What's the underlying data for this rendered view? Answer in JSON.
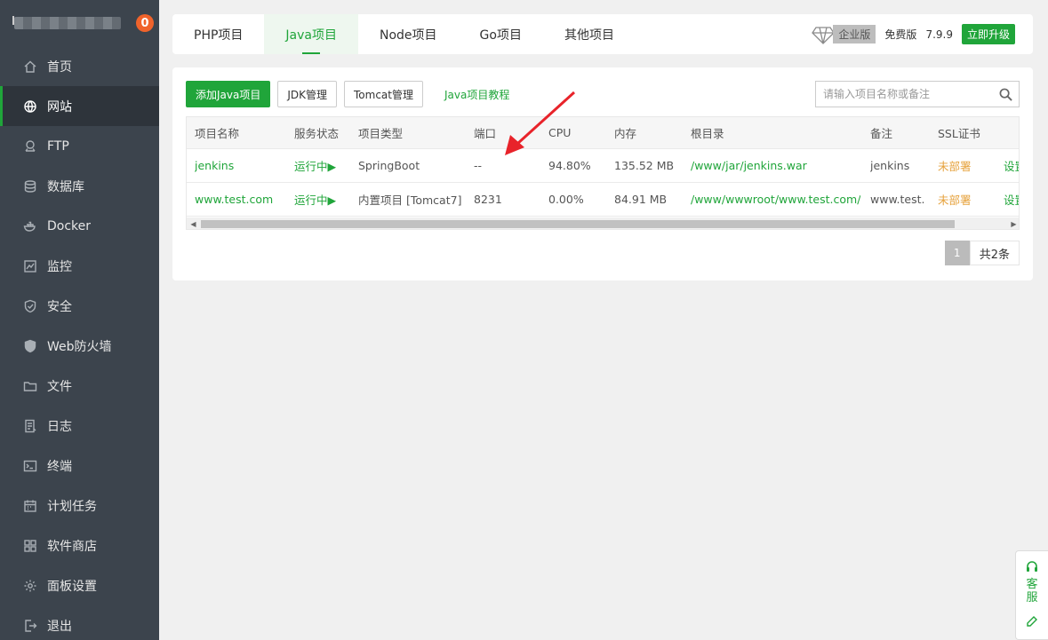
{
  "sidebar": {
    "badge": "0",
    "items": [
      {
        "label": "首页",
        "icon": "home-icon"
      },
      {
        "label": "网站",
        "icon": "globe-icon"
      },
      {
        "label": "FTP",
        "icon": "ftp-icon"
      },
      {
        "label": "数据库",
        "icon": "database-icon"
      },
      {
        "label": "Docker",
        "icon": "docker-icon"
      },
      {
        "label": "监控",
        "icon": "monitor-icon"
      },
      {
        "label": "安全",
        "icon": "shield-icon"
      },
      {
        "label": "Web防火墙",
        "icon": "firewall-icon"
      },
      {
        "label": "文件",
        "icon": "folder-icon"
      },
      {
        "label": "日志",
        "icon": "log-icon"
      },
      {
        "label": "终端",
        "icon": "terminal-icon"
      },
      {
        "label": "计划任务",
        "icon": "calendar-icon"
      },
      {
        "label": "软件商店",
        "icon": "apps-icon"
      },
      {
        "label": "面板设置",
        "icon": "gear-icon"
      },
      {
        "label": "退出",
        "icon": "logout-icon"
      }
    ],
    "active_index": 1
  },
  "topbar": {
    "tabs": [
      "PHP项目",
      "Java项目",
      "Node项目",
      "Go项目",
      "其他项目"
    ],
    "active_tab": 1,
    "enterprise_label": "企业版",
    "free_label": "免费版",
    "version": "7.9.9",
    "upgrade_label": "立即升级"
  },
  "toolbar": {
    "add_label": "添加Java项目",
    "jdk_label": "JDK管理",
    "tomcat_label": "Tomcat管理",
    "tutorial_label": "Java项目教程",
    "search_placeholder": "请输入项目名称或备注"
  },
  "table": {
    "headers": [
      "项目名称",
      "服务状态",
      "项目类型",
      "端口",
      "CPU",
      "内存",
      "根目录",
      "备注",
      "SSL证书",
      ""
    ],
    "rows": [
      {
        "name": "jenkins",
        "status": "运行中▶",
        "type": "SpringBoot",
        "port": "--",
        "cpu": "94.80%",
        "mem": "135.52 MB",
        "root": "/www/jar/jenkins.war",
        "note": "jenkins",
        "ssl": "未部署",
        "op": "设置"
      },
      {
        "name": "www.test.com",
        "status": "运行中▶",
        "type": "内置项目 [Tomcat7]",
        "port": "8231",
        "cpu": "0.00%",
        "mem": "84.91 MB",
        "root": "/www/wwwroot/www.test.com/",
        "note": "www.test.com",
        "ssl": "未部署",
        "op": "设置"
      }
    ]
  },
  "pager": {
    "current": "1",
    "total": "共2条"
  },
  "float_widget": {
    "service_label": "客服"
  },
  "colors": {
    "accent": "#20a53a",
    "sidebar_bg": "#3c444d",
    "badge": "#f0632b",
    "warning": "#e6a23c",
    "annotation": "#e8232a"
  }
}
